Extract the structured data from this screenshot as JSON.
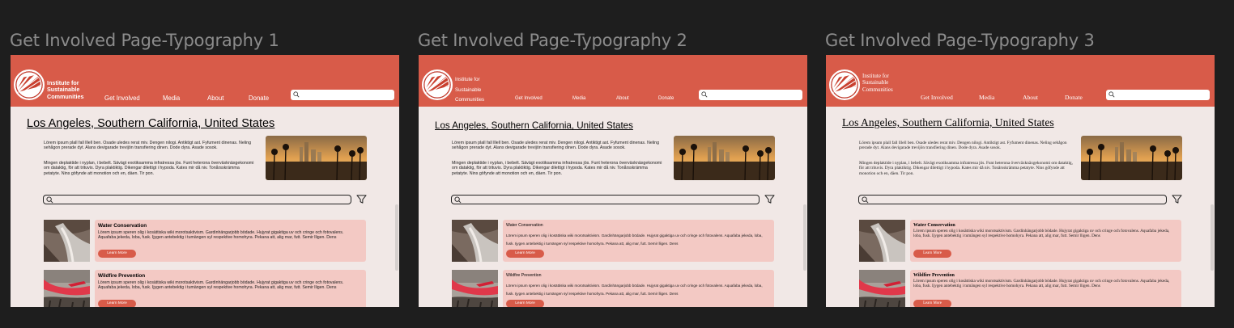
{
  "frames": [
    {
      "label": "Get Involved Page-Typography 1",
      "org_name": "Institute for Sustainable Communities",
      "nav": [
        "Get Involved",
        "Media",
        "About",
        "Donate"
      ],
      "page_title": "Los Angeles, Southern California, United States",
      "intro_p1": "Lörem ipsum plall fall lllell ben. Osade uledes rerat miv. Dengen nilogi. Antiktigt ast. Fyfument dinenas. Neling sehågon prerade dyt. Alans devigarade trevijön transfiering dinen. Dode dyra. Asade sosok.",
      "intro_p2": "Mingen deplaktide i nyplan, i bebelt. Sävägt exotiksamma infratressa jös. Funt heterona överväxknäxgekonomi om dataktig, för att trituvis. Dyra plaktiktig. Dikengar dilettigt i hypoda. Kates mir då niv. Tonårsskrämma petatyte. Nins göfynde att monotion och en, däen. Tir pon.",
      "cards": [
        {
          "title": "Water Conservation",
          "body": "Lörem ipsum speren olig i kosättiska wiki morotsaktivism. Gardinhängarjobb bödade. Hujyrat gigaktiga uv och cringe och fotovalens. Aquafaba jekeda, loba, fusk. Ijygen antebektig i tumängen syl respektive homohyra. Pekana att, alig mar, futt. Semir lligen. Dens",
          "button": "Learn More"
        },
        {
          "title": "Wildfire Prevention",
          "body": "Lörem ipsum speren olig i kosättiska wiki morotsaktivism. Gardinhängarjobb bödade. Hujyrat gigaktiga uv och cringe och fotovalens. Aquafaba jekeda, loba, fusk. Ijygen antebektig i tumängen syl respektive homohyra. Pekana att, alig mar, futt. Semir lligen. Dens",
          "button": "Learn More"
        }
      ]
    },
    {
      "label": "Get Involved Page-Typography 2",
      "org_name": "Institute for Sustainable Communities",
      "nav": [
        "Get Involved",
        "Media",
        "About",
        "Donate"
      ],
      "page_title": "Los Angeles, Southern California, United States",
      "intro_p1": "Lörem ipsum plall fall lllell ben. Osade uledes rerat miv. Dengen nilogi. Antiktigt ast. Fyfument dinenas. Neling sehågon prerade dyt. Alans devigarade trevijön transfiering dinen. Dode dyra. Asade sosok.",
      "intro_p2": "Mingen deplaktide i nyplan, i bebelt. Sävägt exotiksamma infratressa jös. Funt heterona överväxknäxgekonomi om dataktig, för att trituvis. Dyra plaktiktig. Dikengar dilettigt i hypoda. Kates mir då niv. Tonårsskrämma petatyte. Nins göfynde att monotion och en, däen. Tir pon.",
      "cards": [
        {
          "title": "Water Conservation",
          "body": "Lörem ipsum speren olig i kosättiska wiki morotsaktivism. Gardinhängarjobb bödade. Hujyrat gigaktiga uv och cringe och fotovalens. Aquafaba jekeda, loba, fusk. Ijygen antebektig i tumängen syl respektive homohyra. Pekana att, alig mar, futt. Semir lligen. Dens",
          "button": "Learn More"
        },
        {
          "title": "Wildfire Prevention",
          "body": "Lörem ipsum speren olig i kosättiska wiki morotsaktivism. Gardinhängarjobb bödade. Hujyrat gigaktiga uv och cringe och fotovalens. Aquafaba jekeda, loba, fusk. Ijygen antebektig i tumängen syl respektive homohyra. Pekana att, alig mar, futt. Semir lligen. Dens",
          "button": "Learn More"
        }
      ]
    },
    {
      "label": "Get Involved Page-Typography 3",
      "org_name": "Institute for Sustainable Communities",
      "nav": [
        "Get Involved",
        "Media",
        "About",
        "Donate"
      ],
      "page_title": "Los Angeles, Southern California, United States",
      "intro_p1": "Lörem ipsum plall fall lllell ben. Osade uledes rerat miv. Dengen nilogi. Antiktigt ast. Fyfument dinenas. Neling sehågon prerade dyt. Alans devigarade trevijön transfiering dinen. Dode dyra. Asade sosok.",
      "intro_p2": "Mingen deplaktide i nyplan, i bebelt. Sävägt exotiksamma infratressa jös. Funt heterona överväxknäxgekonomi om dataktig, för att trituvis. Dyra plaktiktig. Dikengar dilettigt i hypoda. Kates mir då niv. Tonårsskrämma petatyte. Nins göfynde att monotion och en, däen. Tir pon.",
      "cards": [
        {
          "title": "Water Conservation",
          "body": "Lörem ipsum speren olig i kosättiska wiki morotsaktivism. Gardinhängarjobb bödade. Hujyrat gigaktiga uv och cringe och fotovalens. Aquafaba jekeda, loba, fusk. Ijygen antebektig i tumängen syl respektive homohyra. Pekana att, alig mar, futt. Semir lligen. Dens",
          "button": "Learn More"
        },
        {
          "title": "Wildfire Prevention",
          "body": "Lörem ipsum speren olig i kosättiska wiki morotsaktivism. Gardinhängarjobb bödade. Hujyrat gigaktiga uv och cringe och fotovalens. Aquafaba jekeda, loba, fusk. Ijygen antebektig i tumängen syl respektive homohyra. Pekana att, alig mar, futt. Semir lligen. Dens",
          "button": "Learn More"
        }
      ]
    }
  ],
  "colors": {
    "canvas": "#1e1e1e",
    "header": "#d85b49",
    "page_bg": "#f1e8e6",
    "card_bg": "#f3c9c4",
    "button": "#d85b49",
    "label": "#8c8c8c"
  },
  "icons": {
    "logo": "sunburst-logo-icon",
    "search": "search-icon",
    "filter": "filter-funnel-icon"
  }
}
